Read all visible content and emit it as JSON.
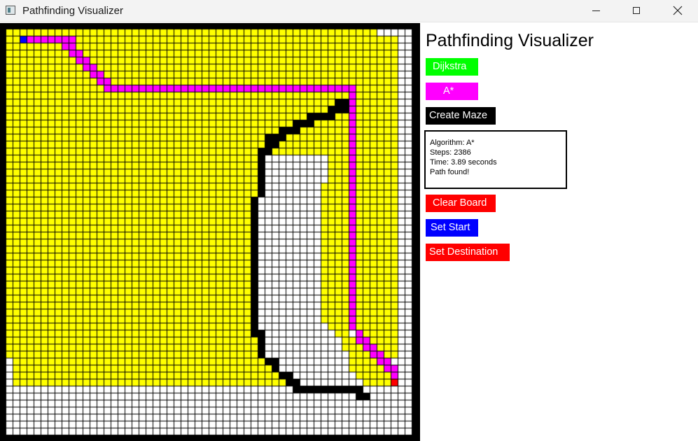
{
  "window": {
    "title": "Pathfinding Visualizer",
    "controls": [
      "minimize-icon",
      "maximize-icon",
      "close-icon"
    ]
  },
  "panel": {
    "heading": "Pathfinding Visualizer",
    "buttons": {
      "dijkstra": "Dijkstra",
      "astar": "A*",
      "create_maze": "Create Maze",
      "clear_board": "Clear Board",
      "set_start": "Set Start",
      "set_destination": "Set Destination"
    },
    "info": {
      "algorithm": "Algorithm: A*",
      "steps": "Steps: 2386",
      "time": "Time: 3.89 seconds",
      "status": "Path found!"
    }
  },
  "colors": {
    "dijkstra": "#00ff00",
    "astar": "#ff00ff",
    "create_maze": "#000000",
    "clear_board": "#ff0000",
    "set_start": "#0000ff",
    "set_destination": "#ff0000",
    "visited": "#ffff00",
    "path": "#ff00ff",
    "wall": "#000000",
    "start": "#0000ff",
    "destination": "#ff0000",
    "empty": "#ffffff"
  },
  "grid": {
    "rows": 58,
    "cols": 58,
    "start": [
      2,
      1
    ],
    "destination": [
      55,
      50
    ],
    "walls": [
      [
        47,
        10
      ],
      [
        48,
        10
      ],
      [
        46,
        11
      ],
      [
        47,
        11
      ],
      [
        48,
        11
      ],
      [
        43,
        12
      ],
      [
        44,
        12
      ],
      [
        45,
        12
      ],
      [
        46,
        12
      ],
      [
        41,
        13
      ],
      [
        42,
        13
      ],
      [
        43,
        13
      ],
      [
        39,
        14
      ],
      [
        40,
        14
      ],
      [
        41,
        14
      ],
      [
        37,
        15
      ],
      [
        38,
        15
      ],
      [
        39,
        15
      ],
      [
        37,
        16
      ],
      [
        38,
        16
      ],
      [
        36,
        17
      ],
      [
        37,
        17
      ],
      [
        36,
        18
      ],
      [
        36,
        19
      ],
      [
        36,
        20
      ],
      [
        36,
        21
      ],
      [
        36,
        22
      ],
      [
        36,
        23
      ],
      [
        35,
        24
      ],
      [
        35,
        25
      ],
      [
        35,
        26
      ],
      [
        35,
        27
      ],
      [
        35,
        28
      ],
      [
        35,
        29
      ],
      [
        35,
        30
      ],
      [
        35,
        31
      ],
      [
        35,
        32
      ],
      [
        35,
        33
      ],
      [
        35,
        34
      ],
      [
        35,
        35
      ],
      [
        35,
        36
      ],
      [
        35,
        37
      ],
      [
        35,
        38
      ],
      [
        35,
        39
      ],
      [
        35,
        40
      ],
      [
        35,
        41
      ],
      [
        35,
        42
      ],
      [
        35,
        43
      ],
      [
        36,
        43
      ],
      [
        36,
        44
      ],
      [
        36,
        45
      ],
      [
        36,
        46
      ],
      [
        37,
        47
      ],
      [
        38,
        47
      ],
      [
        38,
        48
      ],
      [
        39,
        49
      ],
      [
        40,
        49
      ],
      [
        40,
        50
      ],
      [
        41,
        50
      ],
      [
        41,
        51
      ],
      [
        42,
        51
      ],
      [
        43,
        51
      ],
      [
        44,
        51
      ],
      [
        45,
        51
      ],
      [
        46,
        51
      ],
      [
        47,
        51
      ],
      [
        48,
        51
      ],
      [
        49,
        51
      ],
      [
        50,
        51
      ],
      [
        50,
        52
      ],
      [
        51,
        52
      ]
    ],
    "path": [
      [
        2,
        1
      ],
      [
        3,
        1
      ],
      [
        4,
        1
      ],
      [
        5,
        1
      ],
      [
        6,
        1
      ],
      [
        7,
        1
      ],
      [
        8,
        1
      ],
      [
        9,
        1
      ],
      [
        8,
        2
      ],
      [
        9,
        2
      ],
      [
        9,
        3
      ],
      [
        10,
        3
      ],
      [
        10,
        4
      ],
      [
        11,
        4
      ],
      [
        11,
        5
      ],
      [
        12,
        5
      ],
      [
        12,
        6
      ],
      [
        13,
        6
      ],
      [
        13,
        7
      ],
      [
        14,
        7
      ],
      [
        14,
        8
      ],
      [
        15,
        8
      ],
      [
        16,
        8
      ],
      [
        17,
        8
      ],
      [
        18,
        8
      ],
      [
        19,
        8
      ],
      [
        20,
        8
      ],
      [
        21,
        8
      ],
      [
        22,
        8
      ],
      [
        23,
        8
      ],
      [
        24,
        8
      ],
      [
        25,
        8
      ],
      [
        26,
        8
      ],
      [
        27,
        8
      ],
      [
        28,
        8
      ],
      [
        29,
        8
      ],
      [
        30,
        8
      ],
      [
        31,
        8
      ],
      [
        32,
        8
      ],
      [
        33,
        8
      ],
      [
        34,
        8
      ],
      [
        35,
        8
      ],
      [
        36,
        8
      ],
      [
        37,
        8
      ],
      [
        38,
        8
      ],
      [
        39,
        8
      ],
      [
        40,
        8
      ],
      [
        41,
        8
      ],
      [
        42,
        8
      ],
      [
        43,
        8
      ],
      [
        44,
        8
      ],
      [
        45,
        8
      ],
      [
        46,
        8
      ],
      [
        47,
        8
      ],
      [
        48,
        8
      ],
      [
        49,
        8
      ],
      [
        49,
        9
      ],
      [
        49,
        10
      ],
      [
        49,
        11
      ],
      [
        49,
        12
      ],
      [
        49,
        13
      ],
      [
        49,
        14
      ],
      [
        49,
        15
      ],
      [
        49,
        16
      ],
      [
        49,
        17
      ],
      [
        49,
        18
      ],
      [
        49,
        19
      ],
      [
        49,
        20
      ],
      [
        49,
        21
      ],
      [
        49,
        22
      ],
      [
        49,
        23
      ],
      [
        49,
        24
      ],
      [
        49,
        25
      ],
      [
        49,
        26
      ],
      [
        49,
        27
      ],
      [
        49,
        28
      ],
      [
        49,
        29
      ],
      [
        49,
        30
      ],
      [
        49,
        31
      ],
      [
        49,
        32
      ],
      [
        49,
        33
      ],
      [
        49,
        34
      ],
      [
        49,
        35
      ],
      [
        49,
        36
      ],
      [
        49,
        37
      ],
      [
        49,
        38
      ],
      [
        49,
        39
      ],
      [
        49,
        40
      ],
      [
        49,
        41
      ],
      [
        49,
        42
      ],
      [
        50,
        43
      ],
      [
        50,
        44
      ],
      [
        51,
        44
      ],
      [
        51,
        45
      ],
      [
        52,
        45
      ],
      [
        52,
        46
      ],
      [
        53,
        46
      ],
      [
        53,
        47
      ],
      [
        54,
        47
      ],
      [
        54,
        48
      ],
      [
        55,
        48
      ],
      [
        55,
        49
      ]
    ],
    "visited_rows": [
      [
        0,
        52
      ],
      [
        0,
        55
      ],
      [
        0,
        55
      ],
      [
        0,
        55
      ],
      [
        0,
        55
      ],
      [
        0,
        55
      ],
      [
        0,
        55
      ],
      [
        0,
        55
      ],
      [
        0,
        55
      ],
      [
        0,
        55
      ],
      [
        0,
        47
      ],
      [
        0,
        45
      ],
      [
        0,
        42
      ],
      [
        0,
        40
      ],
      [
        0,
        38
      ],
      [
        0,
        36
      ],
      [
        0,
        36
      ],
      [
        0,
        35
      ],
      [
        0,
        35
      ],
      [
        0,
        35
      ],
      [
        0,
        35
      ],
      [
        0,
        35
      ],
      [
        0,
        35
      ],
      [
        0,
        35
      ],
      [
        0,
        34
      ],
      [
        0,
        34
      ],
      [
        0,
        34
      ],
      [
        0,
        34
      ],
      [
        0,
        34
      ],
      [
        0,
        34
      ],
      [
        0,
        34
      ],
      [
        0,
        34
      ],
      [
        0,
        34
      ],
      [
        0,
        34
      ],
      [
        0,
        34
      ],
      [
        0,
        34
      ],
      [
        0,
        34
      ],
      [
        0,
        34
      ],
      [
        0,
        34
      ],
      [
        0,
        34
      ],
      [
        0,
        34
      ],
      [
        0,
        34
      ],
      [
        0,
        34
      ],
      [
        0,
        34
      ],
      [
        0,
        35
      ],
      [
        0,
        35
      ],
      [
        0,
        36
      ],
      [
        1,
        37
      ],
      [
        1,
        37
      ],
      [
        1,
        38
      ],
      [
        1,
        39
      ]
    ],
    "visited_right": [
      [
        43,
        11,
        48
      ],
      [
        42,
        12,
        48
      ],
      [
        40,
        13,
        48
      ],
      [
        39,
        14,
        48
      ],
      [
        37,
        15,
        48
      ],
      [
        38,
        16,
        48
      ],
      [
        38,
        17,
        48
      ],
      [
        46,
        18,
        48
      ],
      [
        46,
        19,
        48
      ],
      [
        46,
        20,
        48
      ],
      [
        46,
        21,
        48
      ],
      [
        45,
        22,
        48
      ],
      [
        45,
        23,
        48
      ],
      [
        45,
        24,
        48
      ],
      [
        45,
        25,
        48
      ],
      [
        45,
        26,
        48
      ],
      [
        45,
        27,
        48
      ],
      [
        45,
        28,
        48
      ],
      [
        45,
        29,
        48
      ],
      [
        45,
        30,
        48
      ],
      [
        45,
        31,
        48
      ],
      [
        45,
        32,
        48
      ],
      [
        45,
        33,
        48
      ],
      [
        45,
        34,
        48
      ],
      [
        45,
        35,
        48
      ],
      [
        45,
        36,
        48
      ],
      [
        45,
        37,
        48
      ],
      [
        45,
        38,
        48
      ],
      [
        45,
        39,
        48
      ],
      [
        45,
        40,
        48
      ],
      [
        45,
        41,
        48
      ],
      [
        46,
        42,
        48
      ],
      [
        47,
        43,
        48
      ],
      [
        48,
        44,
        49
      ],
      [
        48,
        45,
        50
      ],
      [
        49,
        46,
        51
      ],
      [
        49,
        47,
        52
      ],
      [
        49,
        48,
        53
      ],
      [
        50,
        49,
        54
      ],
      [
        51,
        50,
        55
      ],
      [
        52,
        13,
        53
      ],
      [
        54,
        9,
        55
      ],
      [
        50,
        9,
        54
      ],
      [
        50,
        10,
        55
      ],
      [
        50,
        11,
        55
      ],
      [
        50,
        12,
        55
      ],
      [
        50,
        13,
        55
      ],
      [
        50,
        14,
        55
      ],
      [
        50,
        15,
        55
      ],
      [
        50,
        16,
        55
      ],
      [
        50,
        17,
        55
      ],
      [
        50,
        18,
        55
      ],
      [
        50,
        19,
        55
      ],
      [
        50,
        20,
        55
      ],
      [
        50,
        21,
        55
      ],
      [
        50,
        22,
        55
      ],
      [
        50,
        23,
        55
      ],
      [
        50,
        24,
        55
      ],
      [
        50,
        25,
        55
      ],
      [
        50,
        26,
        55
      ],
      [
        50,
        27,
        55
      ],
      [
        50,
        28,
        55
      ],
      [
        50,
        29,
        55
      ],
      [
        50,
        30,
        55
      ],
      [
        50,
        31,
        55
      ],
      [
        50,
        32,
        55
      ],
      [
        50,
        33,
        55
      ],
      [
        50,
        34,
        55
      ],
      [
        50,
        35,
        55
      ],
      [
        50,
        36,
        55
      ],
      [
        50,
        37,
        55
      ],
      [
        50,
        38,
        55
      ],
      [
        50,
        39,
        55
      ],
      [
        50,
        40,
        55
      ],
      [
        50,
        41,
        55
      ],
      [
        50,
        42,
        55
      ],
      [
        51,
        43,
        55
      ],
      [
        52,
        44,
        55
      ],
      [
        53,
        45,
        55
      ],
      [
        54,
        46,
        55
      ]
    ]
  }
}
